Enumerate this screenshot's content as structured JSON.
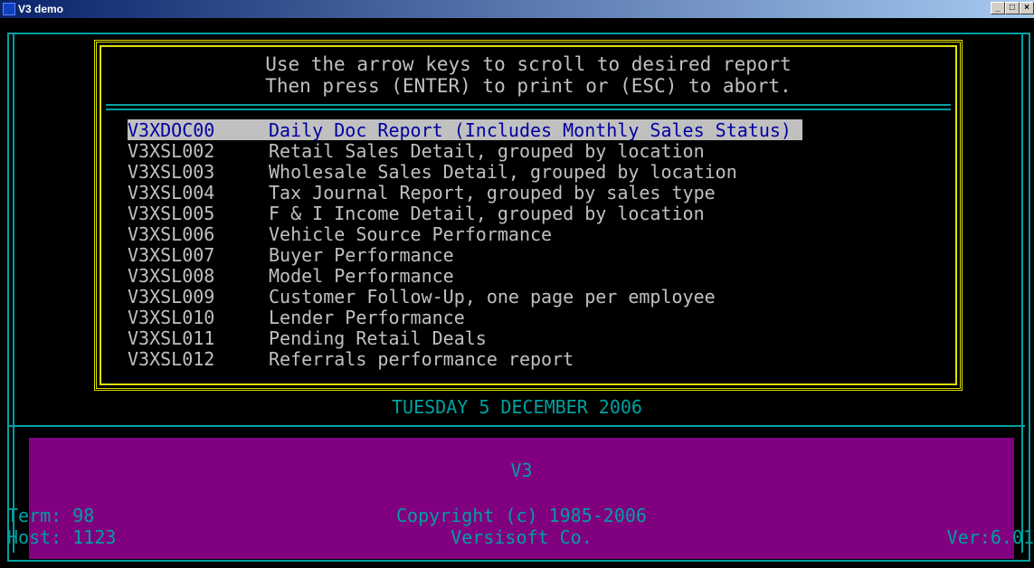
{
  "window": {
    "title": "V3 demo",
    "minimize": "_",
    "maximize": "□",
    "close": "×"
  },
  "header": {
    "line1": "Use the arrow keys to scroll to desired report",
    "line2": "Then press (ENTER) to print or (ESC) to abort."
  },
  "reports": [
    {
      "code": "V3XDOC00",
      "desc": "Daily Doc Report (Includes Monthly Sales Status)"
    },
    {
      "code": "V3XSL002",
      "desc": "Retail Sales Detail, grouped by location"
    },
    {
      "code": "V3XSL003",
      "desc": "Wholesale Sales Detail, grouped by location"
    },
    {
      "code": "V3XSL004",
      "desc": "Tax Journal Report, grouped by sales type"
    },
    {
      "code": "V3XSL005",
      "desc": "F & I Income Detail, grouped by location"
    },
    {
      "code": "V3XSL006",
      "desc": "Vehicle Source Performance"
    },
    {
      "code": "V3XSL007",
      "desc": "Buyer Performance"
    },
    {
      "code": "V3XSL008",
      "desc": "Model Performance"
    },
    {
      "code": "V3XSL009",
      "desc": "Customer Follow-Up, one page per employee"
    },
    {
      "code": "V3XSL010",
      "desc": "Lender Performance"
    },
    {
      "code": "V3XSL011",
      "desc": "Pending Retail Deals"
    },
    {
      "code": "V3XSL012",
      "desc": "Referrals performance report"
    }
  ],
  "date": "TUESDAY 5 DECEMBER 2006",
  "status": {
    "app": "V3",
    "term": "Term: 98",
    "host": "Host: 1123",
    "copyright": "Copyright (c) 1985-2006",
    "company": "Versisoft Co.",
    "version": "Ver:6.01"
  },
  "colors": {
    "teal": "#00a0a0",
    "yellow": "#e0e000",
    "purple": "#800080",
    "selection_bg": "#c0c0c0",
    "selection_fg": "#0000a0"
  }
}
